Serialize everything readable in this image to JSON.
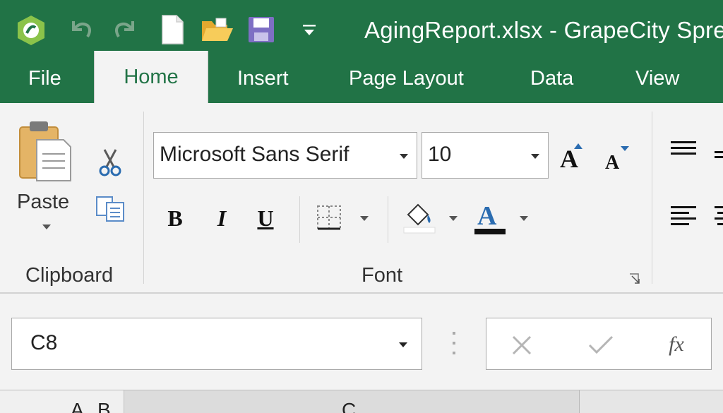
{
  "titlebar": {
    "title": "AgingReport.xlsx - GrapeCity Spre",
    "qat": [
      "app-logo-icon",
      "undo-icon",
      "redo-icon",
      "new-file-icon",
      "open-folder-icon",
      "save-icon",
      "customize-qat-icon"
    ]
  },
  "tabs": [
    {
      "label": "File",
      "active": false
    },
    {
      "label": "Home",
      "active": true
    },
    {
      "label": "Insert",
      "active": false
    },
    {
      "label": "Page Layout",
      "active": false
    },
    {
      "label": "Data",
      "active": false
    },
    {
      "label": "View",
      "active": false
    }
  ],
  "ribbon": {
    "clipboard": {
      "group_label": "Clipboard",
      "paste_label": "Paste"
    },
    "font": {
      "group_label": "Font",
      "font_name": "Microsoft Sans Serif",
      "font_size": "10",
      "bold": "B",
      "italic": "I",
      "underline": "U"
    }
  },
  "formula_bar": {
    "name_box": "C8",
    "fx_label": "fx"
  },
  "grid": {
    "column_headers": [
      "A",
      "B",
      "C"
    ]
  },
  "colors": {
    "accent": "#217346",
    "ribbon_bg": "#f3f3f3"
  }
}
